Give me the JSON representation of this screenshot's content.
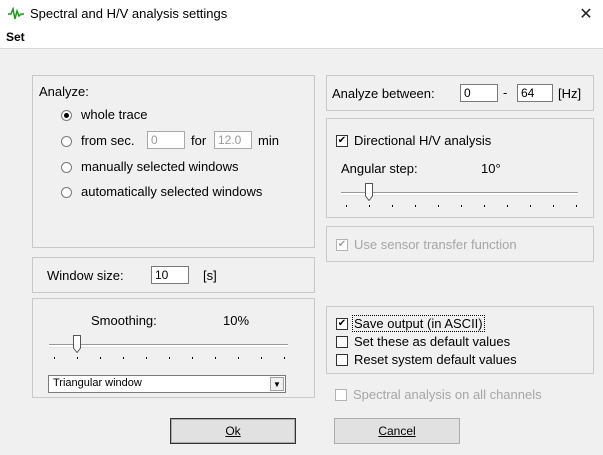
{
  "window": {
    "title": "Spectral and H/V analysis settings",
    "close_glyph": "✕",
    "menu": [
      "Set"
    ]
  },
  "analyze": {
    "heading": "Analyze:",
    "options": [
      {
        "label": "whole trace",
        "checked": true
      },
      {
        "label": "from sec.",
        "checked": false
      },
      {
        "label": "manually selected windows",
        "checked": false
      },
      {
        "label": "automatically selected windows",
        "checked": false
      }
    ],
    "from_sec_value": "0",
    "for_label": "for",
    "for_value": "12.0",
    "min_label": "min"
  },
  "window_size": {
    "label": "Window size:",
    "value": "10",
    "unit": "[s]"
  },
  "smoothing": {
    "label": "Smoothing:",
    "value_text": "10%",
    "slider_level": 0.1,
    "window_type": "Triangular window"
  },
  "analyze_between": {
    "label": "Analyze between:",
    "from": "0",
    "dash": "-",
    "to": "64",
    "unit": "[Hz]"
  },
  "directional": {
    "checked": true,
    "label": "Directional H/V analysis",
    "angular_step_label": "Angular step:",
    "angular_step_value": "10°",
    "slider_level": 0.1
  },
  "sensor": {
    "checked": true,
    "label": "Use sensor transfer function"
  },
  "output": {
    "save": {
      "checked": true,
      "label": "Save output (in ASCII)"
    },
    "set_default": {
      "checked": false,
      "label": "Set these as default values"
    },
    "reset_default": {
      "checked": false,
      "label": "Reset system default values"
    },
    "spectral_all": {
      "checked": false,
      "label": "Spectral analysis on all channels"
    }
  },
  "buttons": {
    "ok": "Ok",
    "cancel": "Cancel"
  },
  "check_glyph": "✔",
  "dropdown_glyph": "▼",
  "colors": {
    "accent": "#00a000",
    "disabled": "#a6a6a6"
  }
}
